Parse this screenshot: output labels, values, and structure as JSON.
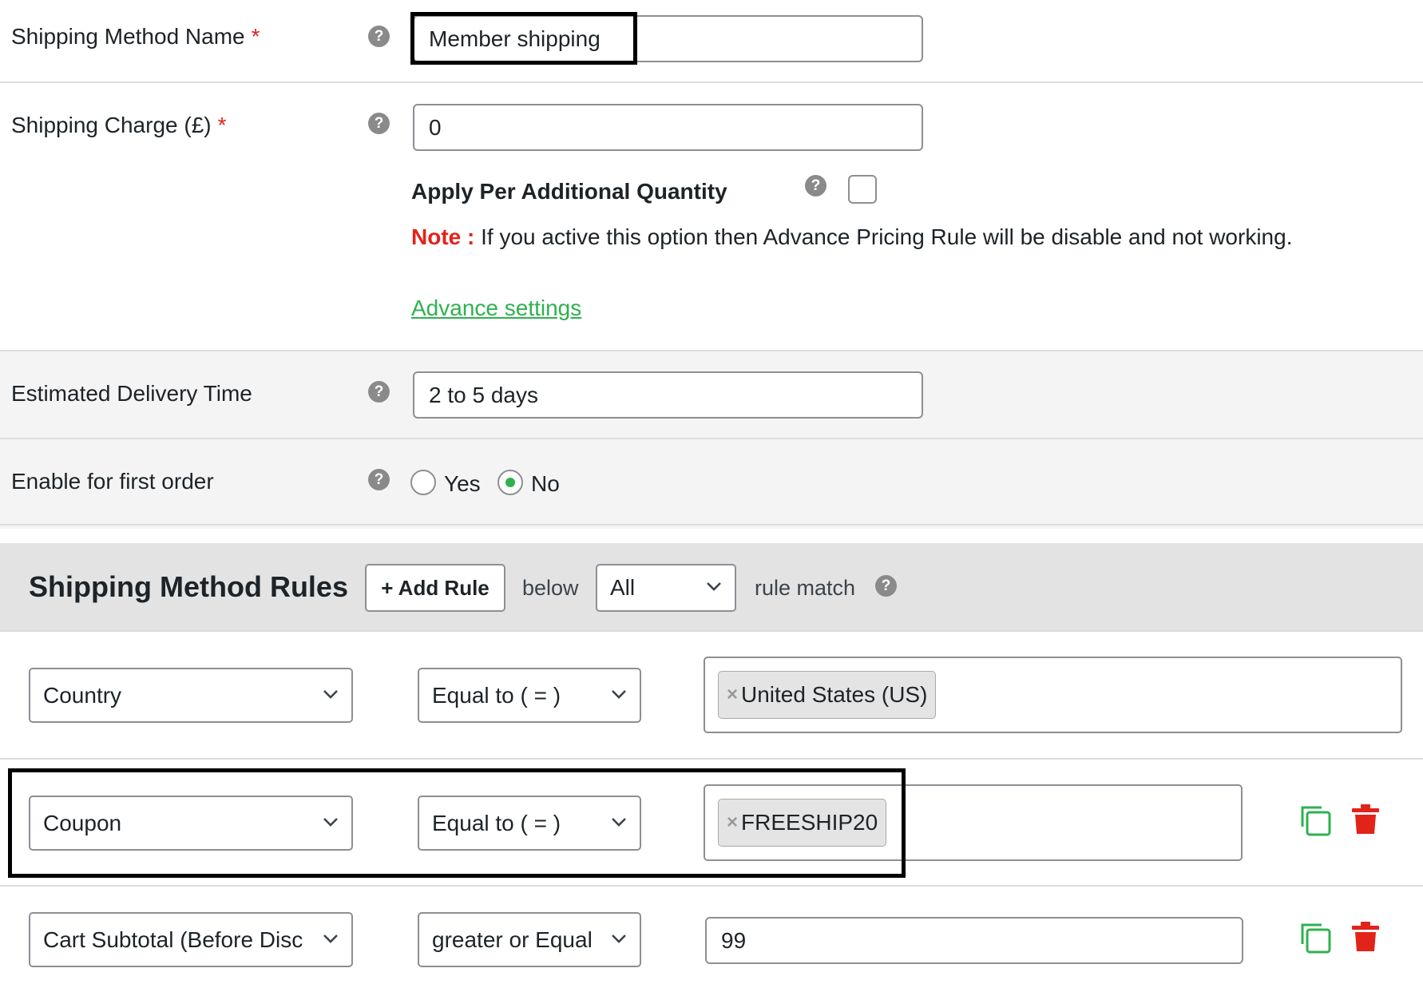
{
  "fields": {
    "method_name": {
      "label": "Shipping Method Name",
      "required_mark": "*",
      "value": "Member shipping"
    },
    "charge": {
      "label": "Shipping Charge (£)",
      "required_mark": "*",
      "value": "0"
    },
    "per_quantity": {
      "label": "Apply Per Additional Quantity",
      "checked": false,
      "note_prefix": "Note :",
      "note_text": "If you active this option then Advance Pricing Rule will be disable and not working."
    },
    "advance_link": "Advance settings",
    "delivery": {
      "label": "Estimated Delivery Time",
      "value": "2 to 5 days"
    },
    "first_order": {
      "label": "Enable for first order",
      "yes": "Yes",
      "no": "No",
      "selected": "No"
    },
    "help_glyph": "?"
  },
  "rules": {
    "title": "Shipping Method Rules",
    "add_rule": "+ Add Rule",
    "below": "below",
    "match_value": "All",
    "rule_match": "rule match",
    "rows": [
      {
        "condition": "Country",
        "operator": "Equal to ( = )",
        "tag_remove": "×",
        "tag": "United States (US)"
      },
      {
        "condition": "Coupon",
        "operator": "Equal to ( = )",
        "tag_remove": "×",
        "tag": "FREESHIP20"
      },
      {
        "condition": "Cart Subtotal (Before Disc",
        "operator": "greater or Equal",
        "value": "99"
      }
    ]
  },
  "colors": {
    "accent_green": "#2fb14f",
    "danger_red": "#e2231a",
    "note_red": "#e2231a",
    "section_gray": "#f4f4f4",
    "rules_header_gray": "#e3e3e3"
  },
  "icons": [
    "help-icon",
    "chevron-down-icon",
    "copy-icon",
    "trash-icon"
  ]
}
